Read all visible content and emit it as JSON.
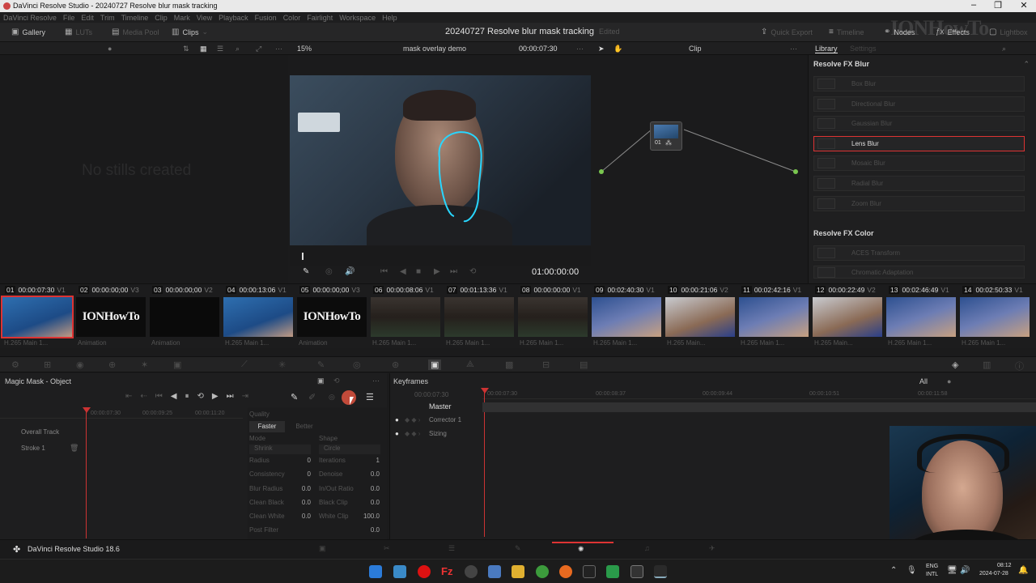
{
  "window": {
    "title": "DaVinci Resolve Studio - 20240727 Resolve blur mask tracking",
    "controls": [
      "–",
      "❐",
      "✕"
    ]
  },
  "menu": [
    "DaVinci Resolve",
    "File",
    "Edit",
    "Trim",
    "Timeline",
    "Clip",
    "Mark",
    "View",
    "Playback",
    "Fusion",
    "Color",
    "Fairlight",
    "Workspace",
    "Help"
  ],
  "toolbar": {
    "gallery": "Gallery",
    "luts": "LUTs",
    "media_pool": "Media Pool",
    "clips": "Clips",
    "project_title": "20240727 Resolve blur mask tracking",
    "edited": "Edited",
    "quick_export": "Quick Export",
    "timeline": "Timeline",
    "nodes": "Nodes",
    "effects": "Effects",
    "lightbox": "Lightbox"
  },
  "viewer_bar": {
    "zoom": "15%",
    "timeline_name": "mask overlay demo",
    "timecode": "00:00:07:30",
    "mode": "Clip",
    "library_tab": "Library",
    "settings_tab": "Settings"
  },
  "stills_message": "No stills created",
  "transport_timecode": "01:00:00:00",
  "node": {
    "label": "01"
  },
  "fx_library": {
    "sections": [
      {
        "title": "Resolve FX Blur",
        "items": [
          "Box Blur",
          "Directional Blur",
          "Gaussian Blur",
          "Lens Blur",
          "Mosaic Blur",
          "Radial Blur",
          "Zoom Blur"
        ],
        "selected": "Lens Blur"
      },
      {
        "title": "Resolve FX Color",
        "items": [
          "ACES Transform",
          "Chromatic Adaptation"
        ]
      }
    ]
  },
  "clips": [
    {
      "num": "01",
      "tc": "00:00:07:30",
      "track": "V1",
      "thumb": "blue",
      "footer": "H.265 Main 1...",
      "selected": true
    },
    {
      "num": "02",
      "tc": "00:00:00;00",
      "track": "V3",
      "thumb": "ion",
      "footer": "Animation",
      "text": "IONHowTo"
    },
    {
      "num": "03",
      "tc": "00:00:00;00",
      "track": "V2",
      "thumb": "dark",
      "footer": "Animation"
    },
    {
      "num": "04",
      "tc": "00:00:13:06",
      "track": "V1",
      "thumb": "blue",
      "footer": "H.265 Main 1..."
    },
    {
      "num": "05",
      "tc": "00:00:00;00",
      "track": "V3",
      "thumb": "ion",
      "footer": "Animation",
      "text": "IONHowTo"
    },
    {
      "num": "06",
      "tc": "00:00:08:06",
      "track": "V1",
      "thumb": "desk",
      "footer": "H.265 Main 1..."
    },
    {
      "num": "07",
      "tc": "00:01:13:36",
      "track": "V1",
      "thumb": "desk",
      "footer": "H.265 Main 1..."
    },
    {
      "num": "08",
      "tc": "00:00:00:00",
      "track": "V1",
      "thumb": "desk",
      "footer": "H.265 Main 1..."
    },
    {
      "num": "09",
      "tc": "00:02:40:30",
      "track": "V1",
      "thumb": "room",
      "footer": "H.265 Main 1..."
    },
    {
      "num": "10",
      "tc": "00:00:21:06",
      "track": "V2",
      "thumb": "mix",
      "footer": "H.265 Main..."
    },
    {
      "num": "11",
      "tc": "00:02:42:16",
      "track": "V1",
      "thumb": "room",
      "footer": "H.265 Main 1..."
    },
    {
      "num": "12",
      "tc": "00:00:22:49",
      "track": "V2",
      "thumb": "mix",
      "footer": "H.265 Main..."
    },
    {
      "num": "13",
      "tc": "00:02:46:49",
      "track": "V1",
      "thumb": "room",
      "footer": "H.265 Main 1..."
    },
    {
      "num": "14",
      "tc": "00:02:50:33",
      "track": "V1",
      "thumb": "room",
      "footer": "H.265 Main 1..."
    }
  ],
  "magic_mask": {
    "title": "Magic Mask - Object",
    "timecodes": [
      "00:00:07:30",
      "00:00:09:25",
      "00:00:11:20"
    ],
    "tracks": [
      "Overall Track",
      "Stroke 1"
    ],
    "quality_label": "Quality",
    "faster": "Faster",
    "better": "Better",
    "mode_label": "Mode",
    "mode_value": "Shrink",
    "shape_label": "Shape",
    "shape_value": "Circle",
    "params": [
      {
        "label": "Radius",
        "value": "0",
        "label2": "Iterations",
        "value2": "1"
      },
      {
        "label": "Consistency",
        "value": "0",
        "label2": "Denoise",
        "value2": "0.0"
      },
      {
        "label": "Blur Radius",
        "value": "0.0",
        "label2": "In/Out Ratio",
        "value2": "0.0"
      },
      {
        "label": "Clean Black",
        "value": "0.0",
        "label2": "Black Clip",
        "value2": "0.0"
      },
      {
        "label": "Clean White",
        "value": "0.0",
        "label2": "White Clip",
        "value2": "100.0"
      },
      {
        "label": "Post Filter",
        "value": "0.0"
      }
    ]
  },
  "keyframes": {
    "title": "Keyframes",
    "filter": "All",
    "ruler": [
      "00:00:07:30",
      "00:00:07:30",
      "00:00:08:37",
      "00:00:09:44",
      "00:00:10:51",
      "00:00:11:58"
    ],
    "rows": [
      "Master",
      "Corrector 1",
      "Sizing"
    ]
  },
  "status": {
    "app": "DaVinci Resolve Studio 18.6"
  },
  "taskbar": {
    "lang1": "ENG",
    "lang2": "INTL",
    "time": "08:12",
    "date": "2024-07-28"
  },
  "watermark": "IONHowTo"
}
